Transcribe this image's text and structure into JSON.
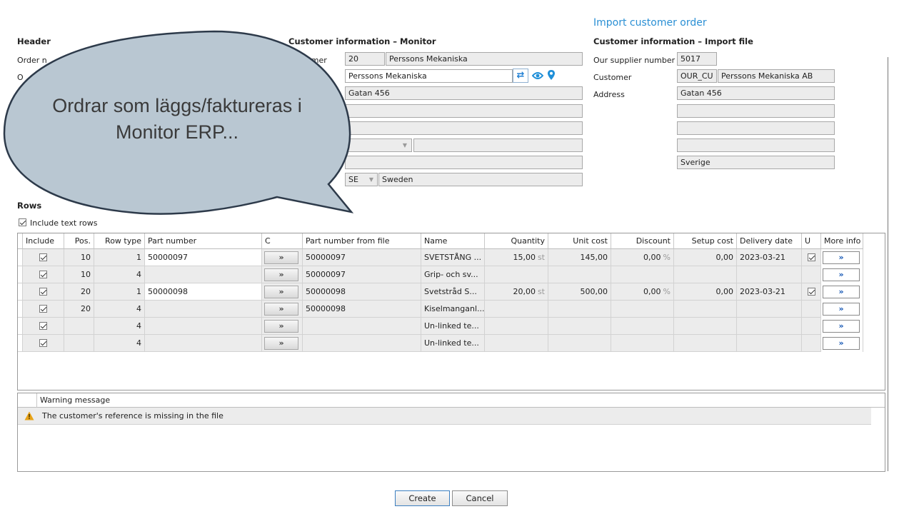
{
  "window_title": "Import customer order",
  "header": {
    "heading": "Header",
    "order_label_fragment": "Order n",
    "o_label_fragment": "O"
  },
  "monitor": {
    "heading": "Customer information – Monitor",
    "customer_label_fragment": "ustomer",
    "on_label_fragment": "on",
    "customer_code": "20",
    "customer_name": "Perssons Mekaniska",
    "name_field": "Perssons Mekaniska",
    "address": "Gatan 456",
    "country_code": "SE",
    "country_name": "Sweden"
  },
  "import_file": {
    "heading": "Customer information – Import file",
    "supplier_label": "Our supplier number",
    "supplier_number": "5017",
    "customer_label": "Customer",
    "customer_code": "OUR_CU",
    "customer_name": "Perssons Mekaniska AB",
    "address_label": "Address",
    "address": "Gatan 456",
    "country": "Sverige"
  },
  "rows": {
    "heading": "Rows",
    "include_text_rows_label": "Include text rows",
    "columns": [
      "Include",
      "Pos.",
      "Row type",
      "Part number",
      "C",
      "Part number from file",
      "Name",
      "Quantity",
      "Unit cost",
      "Discount",
      "Setup cost",
      "Delivery date",
      "U",
      "More info"
    ],
    "items": [
      {
        "pos": "10",
        "row_type": "1",
        "part_number": "50000097",
        "file_part": "50000097",
        "name": "SVETSTÅNG ...",
        "quantity": "15,00",
        "qty_unit": "st",
        "unit_cost": "145,00",
        "discount": "0,00",
        "disc_unit": "%",
        "setup_cost": "0,00",
        "delivery_date": "2023-03-21",
        "u": true
      },
      {
        "pos": "10",
        "row_type": "4",
        "part_number": "",
        "file_part": "50000097",
        "name": "Grip- och sv...",
        "quantity": "",
        "qty_unit": "",
        "unit_cost": "",
        "discount": "",
        "disc_unit": "",
        "setup_cost": "",
        "delivery_date": "",
        "u": false
      },
      {
        "pos": "20",
        "row_type": "1",
        "part_number": "50000098",
        "file_part": "50000098",
        "name": "Svetstråd S...",
        "quantity": "20,00",
        "qty_unit": "st",
        "unit_cost": "500,00",
        "discount": "0,00",
        "disc_unit": "%",
        "setup_cost": "0,00",
        "delivery_date": "2023-03-21",
        "u": true
      },
      {
        "pos": "20",
        "row_type": "4",
        "part_number": "",
        "file_part": "50000098",
        "name": "Kiselmanganl...",
        "quantity": "",
        "qty_unit": "",
        "unit_cost": "",
        "discount": "",
        "disc_unit": "",
        "setup_cost": "",
        "delivery_date": "",
        "u": false
      },
      {
        "pos": "",
        "row_type": "4",
        "part_number": "",
        "file_part": "",
        "name": "Un-linked te...",
        "quantity": "",
        "qty_unit": "",
        "unit_cost": "",
        "discount": "",
        "disc_unit": "",
        "setup_cost": "",
        "delivery_date": "",
        "u": false
      },
      {
        "pos": "",
        "row_type": "4",
        "part_number": "",
        "file_part": "",
        "name": "Un-linked te...",
        "quantity": "",
        "qty_unit": "",
        "unit_cost": "",
        "discount": "",
        "disc_unit": "",
        "setup_cost": "",
        "delivery_date": "",
        "u": false
      }
    ],
    "c_button_label": "»",
    "more_button_label": "»"
  },
  "warnings": {
    "header": "Warning message",
    "messages": [
      "The customer's reference is missing in the file"
    ],
    "icon": "warning-triangle-icon"
  },
  "buttons": {
    "create": "Create",
    "cancel": "Cancel"
  },
  "callout": {
    "line1": "Ordrar som läggs/faktureras i",
    "line2": "Monitor ERP..."
  },
  "colors": {
    "accent": "#2a8fd4",
    "bubble_fill": "#b9c7d2",
    "bubble_stroke": "#2d3a4a",
    "warning": "#e8a317",
    "link_arrow": "#1456b4"
  }
}
